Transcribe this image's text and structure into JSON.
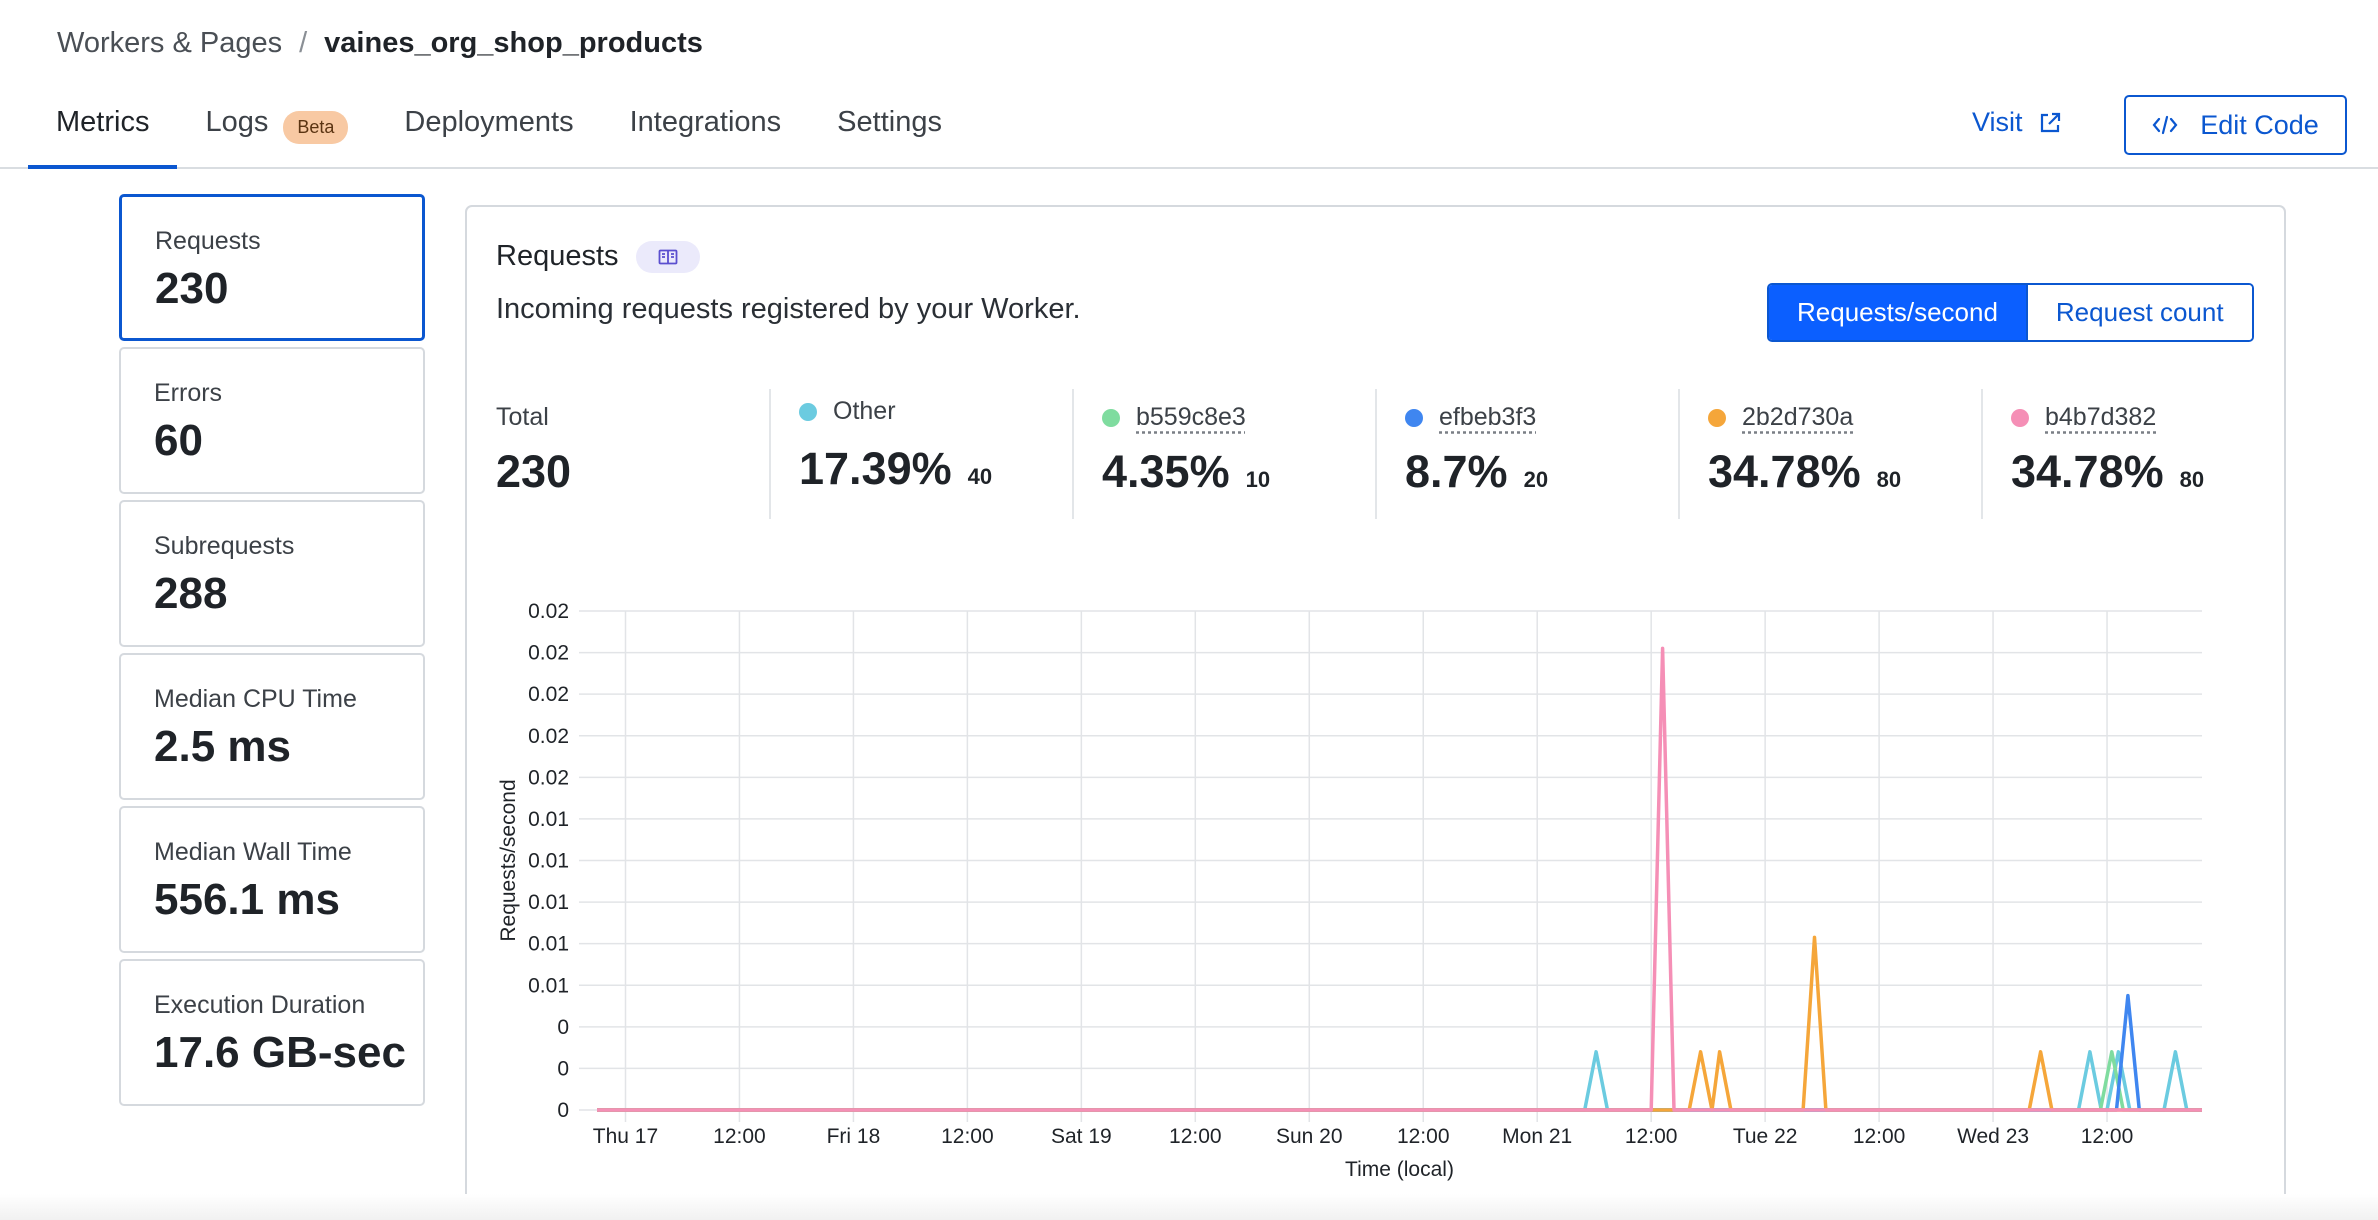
{
  "breadcrumb": {
    "parent": "Workers & Pages",
    "separator": "/",
    "current": "vaines_org_shop_products"
  },
  "tabs": [
    {
      "label": "Metrics",
      "active": true
    },
    {
      "label": "Logs",
      "badge": "Beta"
    },
    {
      "label": "Deployments"
    },
    {
      "label": "Integrations"
    },
    {
      "label": "Settings"
    }
  ],
  "header_actions": {
    "visit_label": "Visit",
    "edit_code_label": "Edit Code"
  },
  "metrics": [
    {
      "label": "Requests",
      "value": "230",
      "active": true
    },
    {
      "label": "Errors",
      "value": "60"
    },
    {
      "label": "Subrequests",
      "value": "288"
    },
    {
      "label": "Median CPU Time",
      "value": "2.5 ms"
    },
    {
      "label": "Median Wall Time",
      "value": "556.1 ms"
    },
    {
      "label": "Execution Duration",
      "value": "17.6 GB-sec"
    }
  ],
  "panel": {
    "title": "Requests",
    "description": "Incoming requests registered by your Worker.",
    "toggle": {
      "left": "Requests/second",
      "right": "Request count",
      "selected": "Requests/second"
    },
    "summary": [
      {
        "name": "Total",
        "value": "230"
      },
      {
        "name": "Other",
        "percent": "17.39%",
        "count": "40",
        "color": "#6bcbe0"
      },
      {
        "name": "b559c8e3",
        "percent": "4.35%",
        "count": "10",
        "color": "#7fdc9f"
      },
      {
        "name": "efbeb3f3",
        "percent": "8.7%",
        "count": "20",
        "color": "#3f86f0"
      },
      {
        "name": "2b2d730a",
        "percent": "34.78%",
        "count": "80",
        "color": "#f5a63a"
      },
      {
        "name": "b4b7d382",
        "percent": "34.78%",
        "count": "80",
        "color": "#f58fb6"
      }
    ]
  },
  "chart_data": {
    "type": "line",
    "ylabel": "Requests/second",
    "xlabel": "Time (local)",
    "ylim": [
      0,
      0.024
    ],
    "y_tick_labels": [
      "0",
      "0",
      "0",
      "0.01",
      "0.01",
      "0.01",
      "0.01",
      "0.01",
      "0.02",
      "0.02",
      "0.02",
      "0.02",
      "0.02"
    ],
    "x_tick_labels": [
      "Thu 17",
      "12:00",
      "Fri 18",
      "12:00",
      "Sat 19",
      "12:00",
      "Sun 20",
      "12:00",
      "Mon 21",
      "12:00",
      "Tue 22",
      "12:00",
      "Wed 23",
      "12:00"
    ],
    "x_range_hours": [
      -3,
      166
    ],
    "grid": true,
    "series": [
      {
        "name": "Other",
        "color": "#6bcbe0",
        "x": [
          -3,
          101,
          102.2,
          103.4,
          153,
          154.2,
          155.4,
          156,
          157.2,
          158.4,
          162,
          163.2,
          164.4,
          166
        ],
        "y": [
          0,
          0,
          0.0028,
          0,
          0,
          0.0028,
          0,
          0,
          0.0028,
          0,
          0,
          0.0028,
          0,
          0
        ]
      },
      {
        "name": "b559c8e3",
        "color": "#7fdc9f",
        "x": [
          -3,
          155.3,
          156.5,
          157.7,
          166
        ],
        "y": [
          0,
          0,
          0.0028,
          0,
          0
        ]
      },
      {
        "name": "efbeb3f3",
        "color": "#3f86f0",
        "x": [
          -3,
          157,
          158.2,
          159.4,
          166
        ],
        "y": [
          0,
          0,
          0.0055,
          0,
          0
        ]
      },
      {
        "name": "2b2d730a",
        "color": "#f5a63a",
        "x": [
          -3,
          112,
          113.2,
          114.4,
          115.2,
          116.4,
          124,
          125.2,
          126.4,
          147.8,
          149,
          150.2,
          166
        ],
        "y": [
          0,
          0,
          0.0028,
          0,
          0.0028,
          0,
          0,
          0.0083,
          0,
          0,
          0.0028,
          0,
          0
        ]
      },
      {
        "name": "b4b7d382",
        "color": "#f58fb6",
        "x": [
          -3,
          108,
          109.2,
          110.4,
          166
        ],
        "y": [
          0,
          0,
          0.0222,
          0,
          0
        ]
      }
    ]
  }
}
